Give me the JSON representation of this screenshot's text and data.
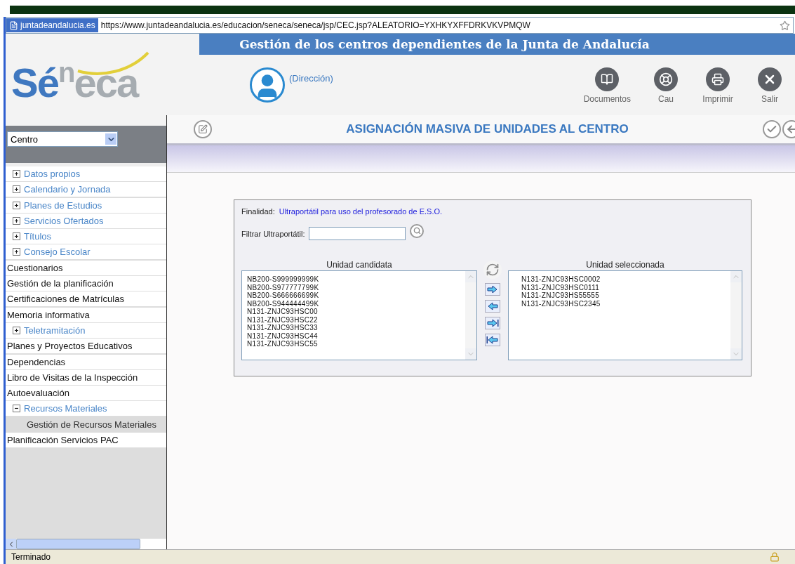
{
  "browser": {
    "site_badge": "juntadeandalucia.es",
    "url": "https://www.juntadeandalucia.es/educacion/seneca/seneca/jsp/CEC.jsp?ALEATORIO=YXHKYXFFDRKVKVPMQW"
  },
  "header": {
    "logo": [
      "Sé",
      "n",
      "eca"
    ],
    "banner": "Gestión de los centros dependientes de la Junta de Andalucía",
    "user_role": "(Dirección)",
    "toolbar": [
      {
        "label": "Documentos",
        "kind": "book"
      },
      {
        "label": "Cau",
        "kind": "support"
      },
      {
        "label": "Imprimir",
        "kind": "print"
      },
      {
        "label": "Salir",
        "kind": "exit"
      }
    ]
  },
  "sidebar": {
    "selector": "Centro",
    "items": [
      {
        "label": "Datos propios",
        "kind": "folder",
        "expanded": false,
        "selected": false
      },
      {
        "label": "Calendario y Jornada",
        "kind": "folder",
        "expanded": false,
        "selected": false
      },
      {
        "label": "Planes de Estudios",
        "kind": "folder",
        "expanded": false,
        "selected": false
      },
      {
        "label": "Servicios Ofertados",
        "kind": "folder",
        "expanded": false,
        "selected": false
      },
      {
        "label": "Títulos",
        "kind": "folder",
        "expanded": false,
        "selected": false
      },
      {
        "label": "Consejo Escolar",
        "kind": "folder",
        "expanded": false,
        "selected": false
      },
      {
        "label": "Cuestionarios",
        "kind": "link",
        "selected": false
      },
      {
        "label": "Gestión de la planificación",
        "kind": "link",
        "selected": false
      },
      {
        "label": "Certificaciones de Matrículas",
        "kind": "link",
        "selected": false
      },
      {
        "label": "Memoria informativa",
        "kind": "link",
        "selected": false
      },
      {
        "label": "Teletramitación",
        "kind": "folder",
        "expanded": false,
        "selected": false
      },
      {
        "label": "Planes y Proyectos Educativos",
        "kind": "link",
        "selected": false
      },
      {
        "label": "Dependencias",
        "kind": "link",
        "selected": false
      },
      {
        "label": "Libro de Visitas de la Inspección",
        "kind": "link",
        "selected": false
      },
      {
        "label": "Autoevaluación",
        "kind": "link",
        "selected": false
      },
      {
        "label": "Recursos Materiales",
        "kind": "folder",
        "expanded": true,
        "selected": false,
        "children": [
          {
            "label": "Gestión de Recursos Materiales",
            "selected": true
          }
        ]
      },
      {
        "label": "Planificación Servicios PAC",
        "kind": "link",
        "selected": false
      }
    ]
  },
  "page": {
    "title": "ASIGNACIÓN MASIVA DE UNIDADES AL CENTRO",
    "purpose_label": "Finalidad:",
    "purpose": "Ultraportátil para uso del profesorado de E.S.O.",
    "filter_label": "Filtrar Ultraportátil:",
    "candidates": {
      "title": "Unidad candidata",
      "items": [
        "NB200-S999999999K",
        "NB200-S977777799K",
        "NB200-S666666699K",
        "NB200-S944444499K",
        "N131-ZNJC93HSC00",
        "N131-ZNJC93HSC22",
        "N131-ZNJC93HSC33",
        "N131-ZNJC93HSC44",
        "N131-ZNJC93HSC55"
      ]
    },
    "chosen": {
      "title": "Unidad seleccionada",
      "items": [
        "N131-ZNJC93HSC0002",
        "N131-ZNJC93HSC0111",
        "N131-ZNJC93HS55555",
        "N131-ZNJC93HSC2345"
      ]
    }
  },
  "status_bar": {
    "text": "Terminado"
  }
}
